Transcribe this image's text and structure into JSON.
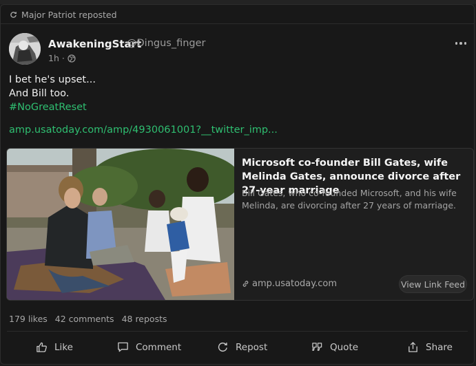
{
  "repost_banner": {
    "text": "Major Patriot reposted",
    "icon": "repost-icon"
  },
  "post": {
    "author_name": "AwakeningStart",
    "author_handle": "@Dingus_finger",
    "time": "1h",
    "separator": "·",
    "text_lines": [
      "I bet he's upset...",
      "And Bill too."
    ],
    "hashtag": "#NoGreatReset",
    "url": "amp.usatoday.com/amp/4930061001?__twitter_imp..."
  },
  "link_card": {
    "title": "Microsoft co-founder Bill Gates, wife Melinda Gates, announce divorce after 27-year marriage",
    "description": "Bill Gates, who co-founded Microsoft, and his wife Melinda, are divorcing after 27 years of marriage.",
    "domain": "amp.usatoday.com",
    "view_feed_label": "View Link Feed"
  },
  "stats": {
    "likes": "179 likes",
    "comments": "42 comments",
    "reposts": "48 reposts"
  },
  "actions": {
    "like": "Like",
    "comment": "Comment",
    "repost": "Repost",
    "quote": "Quote",
    "share": "Share"
  },
  "colors": {
    "accent": "#2fbf71",
    "background": "#181818",
    "text": "#e8e8e8",
    "muted": "#9b9b9b"
  }
}
